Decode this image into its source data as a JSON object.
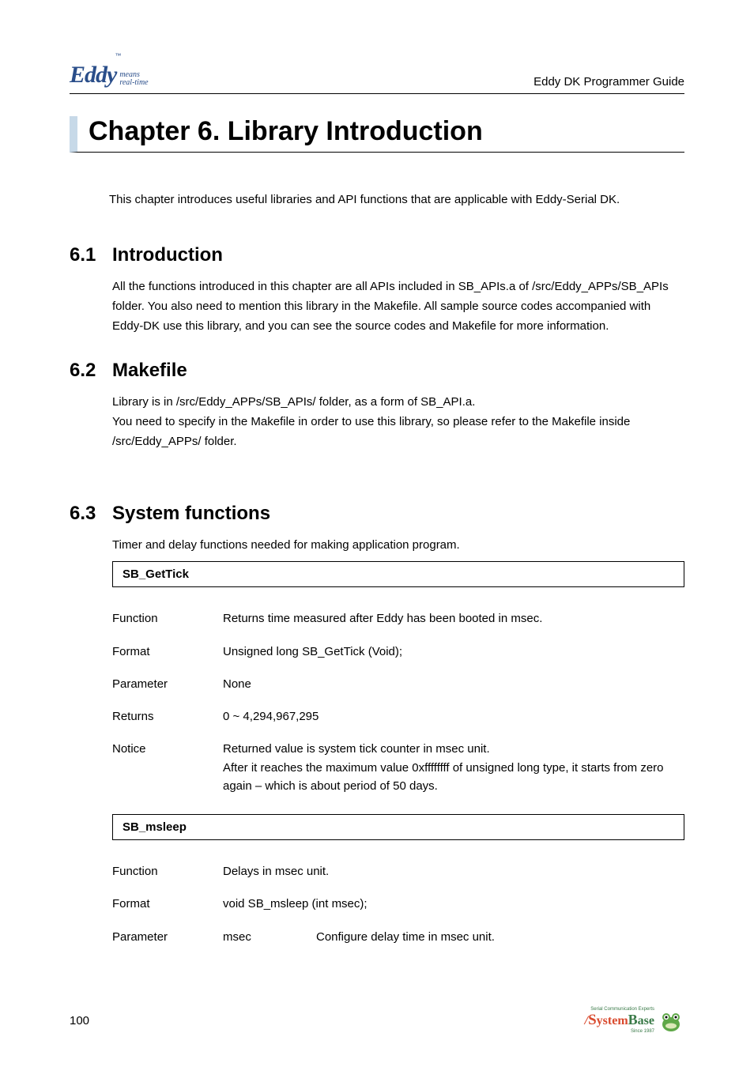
{
  "header": {
    "logo_main": "Eddy",
    "logo_tm": "™",
    "logo_sub_1": "means",
    "logo_sub_2": "real-time",
    "right": "Eddy DK Programmer Guide"
  },
  "chapter": {
    "title": "Chapter 6.    Library  Introduction",
    "intro": "This chapter introduces useful libraries and API functions that are applicable with Eddy-Serial DK."
  },
  "sections": {
    "s61": {
      "num": "6.1",
      "title": "Introduction",
      "body": "All the functions introduced in this chapter are all APIs included in SB_APIs.a of /src/Eddy_APPs/SB_APIs folder. You also need to mention this library in the Makefile. All sample source codes accompanied with Eddy-DK use this library, and you can see the source codes and Makefile for more information."
    },
    "s62": {
      "num": "6.2",
      "title": "Makefile",
      "body": "Library is in /src/Eddy_APPs/SB_APIs/ folder, as a form of SB_API.a.\nYou need to specify in the Makefile in order to use this library, so please refer to the Makefile inside /src/Eddy_APPs/ folder."
    },
    "s63": {
      "num": "6.3",
      "title": "System  functions",
      "body": "Timer and delay functions needed for making application program."
    }
  },
  "api1": {
    "name": "SB_GetTick",
    "rows": {
      "Function": "Returns time measured after Eddy has been booted in msec.",
      "Format": "Unsigned long    SB_GetTick (Void);",
      "Parameter": "None",
      "Returns": "0 ~ 4,294,967,295",
      "Notice": "Returned value is system tick counter in msec unit.\nAfter it reaches the maximum value 0xffffffff of unsigned long type, it starts from zero again – which is about period of 50 days."
    }
  },
  "api2": {
    "name": "SB_msleep",
    "rows": {
      "Function": "Delays in msec unit.",
      "Format": "void SB_msleep (int msec);",
      "ParameterName": "msec",
      "ParameterDesc": "Configure delay time in msec unit."
    }
  },
  "labels": {
    "Function": "Function",
    "Format": "Format",
    "Parameter": "Parameter",
    "Returns": "Returns",
    "Notice": "Notice"
  },
  "footer": {
    "page": "100",
    "logo_tag_1": "Serial Communication Experts",
    "logo_tag_2": "Since 1987"
  }
}
